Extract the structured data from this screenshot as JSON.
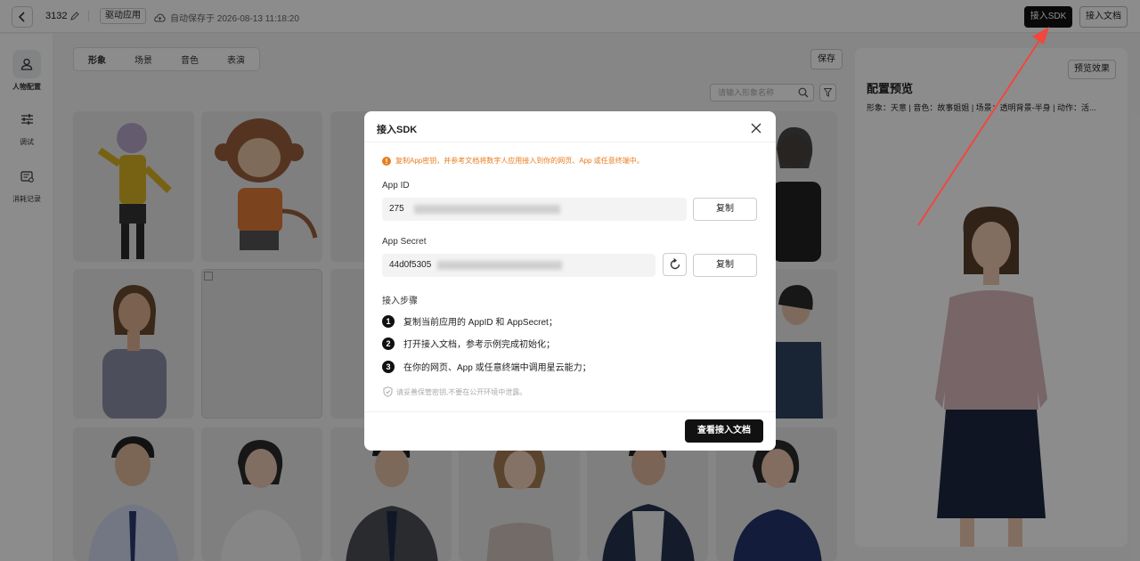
{
  "header": {
    "app_id": "3132",
    "app_tag": "驱动应用",
    "autosave_text": "自动保存于 2026-08-13 11:18:20",
    "sdk_button": "接入SDK",
    "doc_button": "接入文档"
  },
  "sidebar": {
    "items": [
      {
        "label": "人物配置",
        "icon": "person-icon",
        "active": true
      },
      {
        "label": "调试",
        "icon": "sliders-icon",
        "active": false
      },
      {
        "label": "消耗记录",
        "icon": "receipt-icon",
        "active": false
      }
    ]
  },
  "main": {
    "tabs": [
      {
        "label": "形象",
        "active": true
      },
      {
        "label": "场景",
        "active": false
      },
      {
        "label": "音色",
        "active": false
      },
      {
        "label": "表演",
        "active": false
      }
    ],
    "save_button": "保存",
    "search_placeholder": "请输入形象名称"
  },
  "preview": {
    "button": "预览效果",
    "title": "配置预览",
    "meta": "形象：天意  |  音色：故事姐姐  |  场景：透明背景-半身  |  动作：活..."
  },
  "modal": {
    "title": "接入SDK",
    "tip": "复制App密钥，并参考文档将数字人应用接入到你的网页、App 或任意终端中。",
    "app_id_label": "App ID",
    "app_id_value": "275",
    "app_secret_label": "App Secret",
    "app_secret_value": "44d0f5305",
    "copy_label": "复制",
    "steps_title": "接入步骤",
    "steps": [
      {
        "num": "1",
        "text": "复制当前应用的 AppID 和 AppSecret；"
      },
      {
        "num": "2",
        "text": "打开接入文档，参考示例完成初始化；"
      },
      {
        "num": "3",
        "text": "在你的网页、App 或任意终端中调用星云能力；"
      }
    ],
    "note": "请妥善保管密钥,不要在公开环境中泄露。",
    "view_doc_button": "查看接入文档"
  },
  "colors": {
    "primary": "#111111",
    "warning": "#e87c1e",
    "overlay": "rgba(0,0,0,0.45)",
    "annotation_arrow": "#f0473f"
  }
}
